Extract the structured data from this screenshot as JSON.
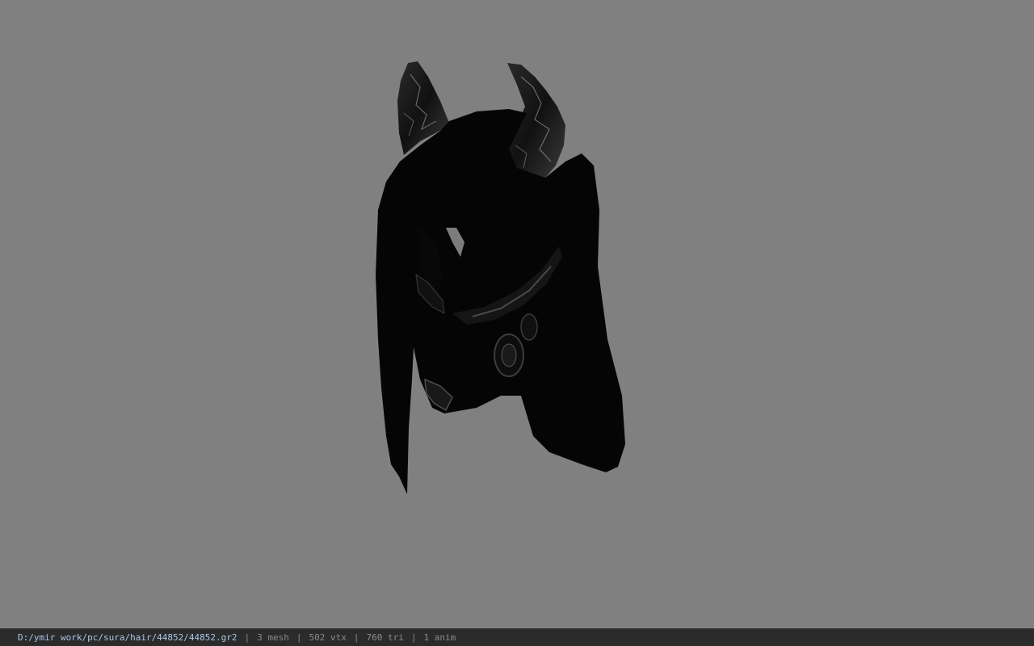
{
  "viewport": {
    "background_color": "#808080",
    "model_color": "#050505",
    "highlight_color": "#5a5a5a"
  },
  "status_bar": {
    "file_path": "D:/ymir work/pc/sura/hair/44852/44852.gr2",
    "separator": "|",
    "mesh_count": "3 mesh",
    "vertex_count": "502 vtx",
    "triangle_count": "760 tri",
    "anim_count": "1 anim"
  }
}
